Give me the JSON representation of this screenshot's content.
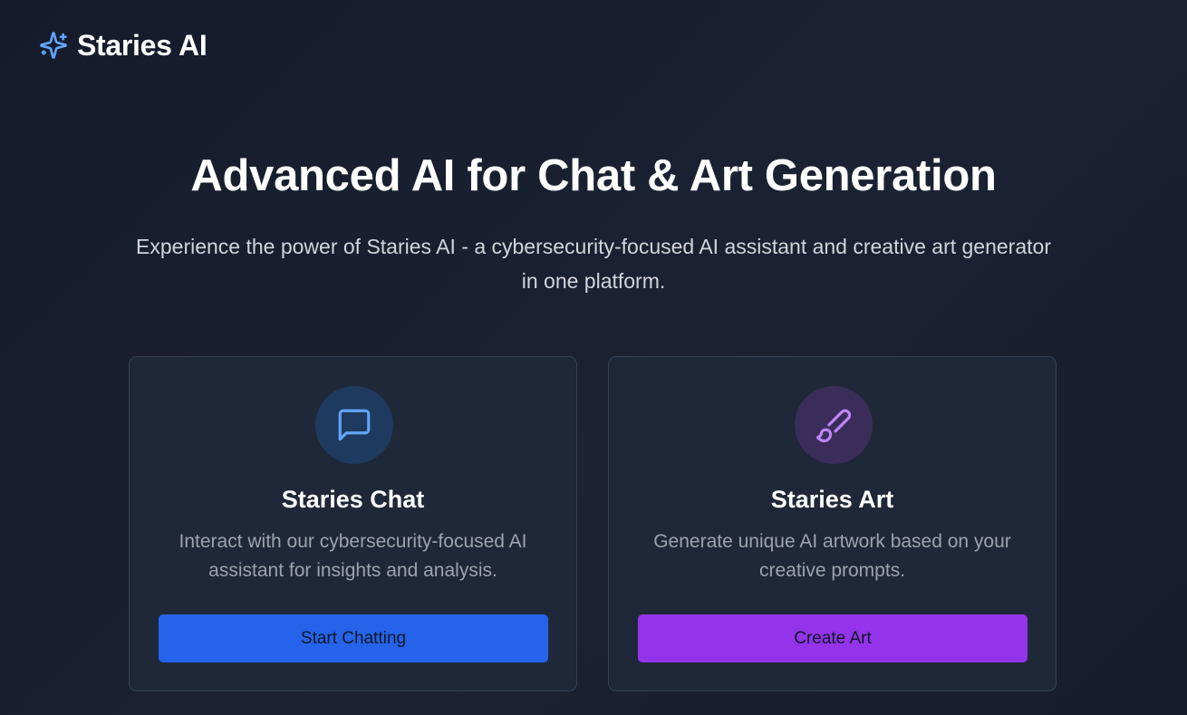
{
  "brand": {
    "name": "Staries AI",
    "icon": "sparkles-icon",
    "accent_color": "#60a5fa"
  },
  "hero": {
    "title": "Advanced AI for Chat & Art Generation",
    "subtitle": "Experience the power of Staries AI - a cybersecurity-focused AI assistant and creative art generator in one platform."
  },
  "cards": [
    {
      "icon": "message-square-icon",
      "icon_color": "#60a5fa",
      "title": "Staries Chat",
      "description": "Interact with our cybersecurity-focused AI assistant for insights and analysis.",
      "button_label": "Start Chatting",
      "button_color": "#2563eb"
    },
    {
      "icon": "paintbrush-icon",
      "icon_color": "#c084fc",
      "title": "Staries Art",
      "description": "Generate unique AI artwork based on your creative prompts.",
      "button_label": "Create Art",
      "button_color": "#9333ea"
    }
  ]
}
